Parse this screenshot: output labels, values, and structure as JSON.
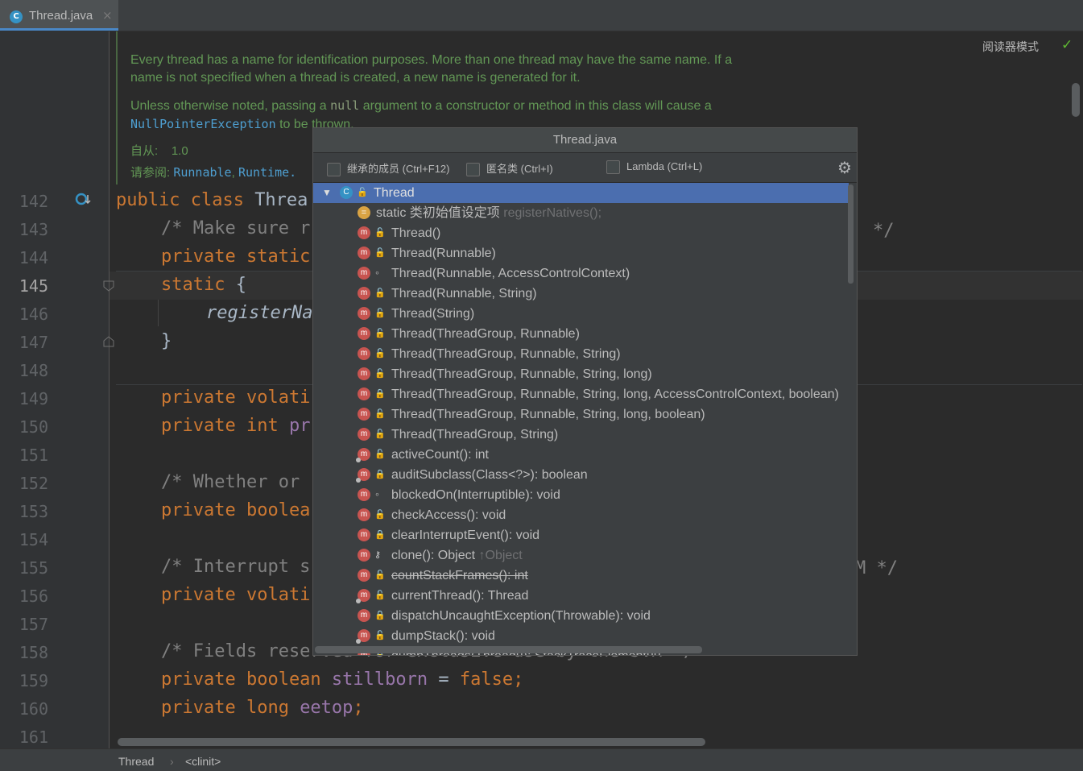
{
  "editor_tab": {
    "file_name": "Thread.java",
    "close_glyph": "×"
  },
  "reader_mode": {
    "label": "阅读器模式",
    "check_glyph": "✓"
  },
  "doc": {
    "para1_line1": "Every thread has a name for identification purposes. More than one thread may have the same name. If a",
    "para1_line2": "name is not specified when a thread is created, a new name is generated for it.",
    "para2_line1_pre": "Unless otherwise noted, passing a ",
    "para2_code": "null",
    "para2_line1_post": " argument to a constructor or method in this class will cause a",
    "para2_line2_link": "NullPointerException",
    "para2_line2_post": " to be thrown.",
    "since_label": "自从:",
    "since_value": "1.0",
    "see_label": "请参阅:",
    "see_link1": "Runnable",
    "see_sep": ",",
    "see_link2": "Runtime."
  },
  "line_numbers": [
    "142",
    "143",
    "144",
    "145",
    "146",
    "147",
    "148",
    "149",
    "150",
    "151",
    "152",
    "153",
    "154",
    "155",
    "156",
    "157",
    "158",
    "159",
    "160",
    "161"
  ],
  "current_line": "145",
  "code": {
    "l142_kw": "public class ",
    "l142_rest": "Threa",
    "l143": "/* Make sure r",
    "l143_tail": "*/",
    "l144_kw": "private static",
    "l145_kw": "static",
    "l145_rest": " {",
    "l146": "registerNa",
    "l147": "}",
    "l149_kw": "private volati",
    "l150_kw": "private int ",
    "l150_rest": "pr",
    "l152": "/* Whether or",
    "l153_kw": "private boolea",
    "l155": "/* Interrupt s",
    "l155_tail": "M */",
    "l156_kw": "private volati",
    "l158": "/* Fields reserved for exclusive use by the JVM */",
    "l159_kw": "private boolean ",
    "l159_fld": "stillborn",
    "l159_op": " = ",
    "l159_val": "false",
    "l159_end": ";",
    "l160_kw": "private long ",
    "l160_fld": "eetop",
    "l160_end": ";"
  },
  "status_bar": {
    "crumb1": "Thread",
    "sep": "›",
    "crumb2": "<clinit>"
  },
  "popup": {
    "title": "Thread.java",
    "options": [
      {
        "label": "继承的成员 (Ctrl+F12)",
        "checked": false
      },
      {
        "label": "匿名类 (Ctrl+I)",
        "checked": false
      },
      {
        "label": "Lambda (Ctrl+L)",
        "checked": false
      }
    ],
    "settings_icon": "⚙",
    "root": {
      "label": "Thread",
      "expanded": true
    },
    "items": [
      {
        "kind": "init",
        "text": "static 类初始值设定项",
        "hint": "registerNatives();"
      },
      {
        "kind": "method",
        "vis": "pub",
        "text": "Thread()"
      },
      {
        "kind": "method",
        "vis": "pub",
        "text": "Thread(Runnable)"
      },
      {
        "kind": "method",
        "vis": "pkg",
        "text": "Thread(Runnable, AccessControlContext)"
      },
      {
        "kind": "method",
        "vis": "pub",
        "text": "Thread(Runnable, String)"
      },
      {
        "kind": "method",
        "vis": "pub",
        "text": "Thread(String)"
      },
      {
        "kind": "method",
        "vis": "pub",
        "text": "Thread(ThreadGroup, Runnable)"
      },
      {
        "kind": "method",
        "vis": "pub",
        "text": "Thread(ThreadGroup, Runnable, String)"
      },
      {
        "kind": "method",
        "vis": "pub",
        "text": "Thread(ThreadGroup, Runnable, String, long)"
      },
      {
        "kind": "method",
        "vis": "prv",
        "text": "Thread(ThreadGroup, Runnable, String, long, AccessControlContext, boolean)"
      },
      {
        "kind": "method",
        "vis": "pub",
        "text": "Thread(ThreadGroup, Runnable, String, long, boolean)"
      },
      {
        "kind": "method",
        "vis": "pub",
        "text": "Thread(ThreadGroup, String)"
      },
      {
        "kind": "method",
        "vis": "pub",
        "static": true,
        "text": "activeCount(): int"
      },
      {
        "kind": "method",
        "vis": "prv",
        "static": true,
        "text": "auditSubclass(Class<?>): boolean"
      },
      {
        "kind": "method",
        "vis": "pkg",
        "text": "blockedOn(Interruptible): void"
      },
      {
        "kind": "method",
        "vis": "pub",
        "text": "checkAccess(): void"
      },
      {
        "kind": "method",
        "vis": "prv",
        "text": "clearInterruptEvent(): void"
      },
      {
        "kind": "method",
        "vis": "prot",
        "text": "clone(): Object",
        "hint": "↑Object"
      },
      {
        "kind": "method",
        "vis": "pub",
        "strike": true,
        "text": "countStackFrames(): int"
      },
      {
        "kind": "method",
        "vis": "pub",
        "static": true,
        "text": "currentThread(): Thread"
      },
      {
        "kind": "method",
        "vis": "prv",
        "text": "dispatchUncaughtException(Throwable): void"
      },
      {
        "kind": "method",
        "vis": "pub",
        "static": true,
        "text": "dumpStack(): void"
      },
      {
        "kind": "method",
        "vis": "prv",
        "static": true,
        "text": "dumpThreads(Thread[]): StackTraceElement[][]"
      }
    ]
  }
}
